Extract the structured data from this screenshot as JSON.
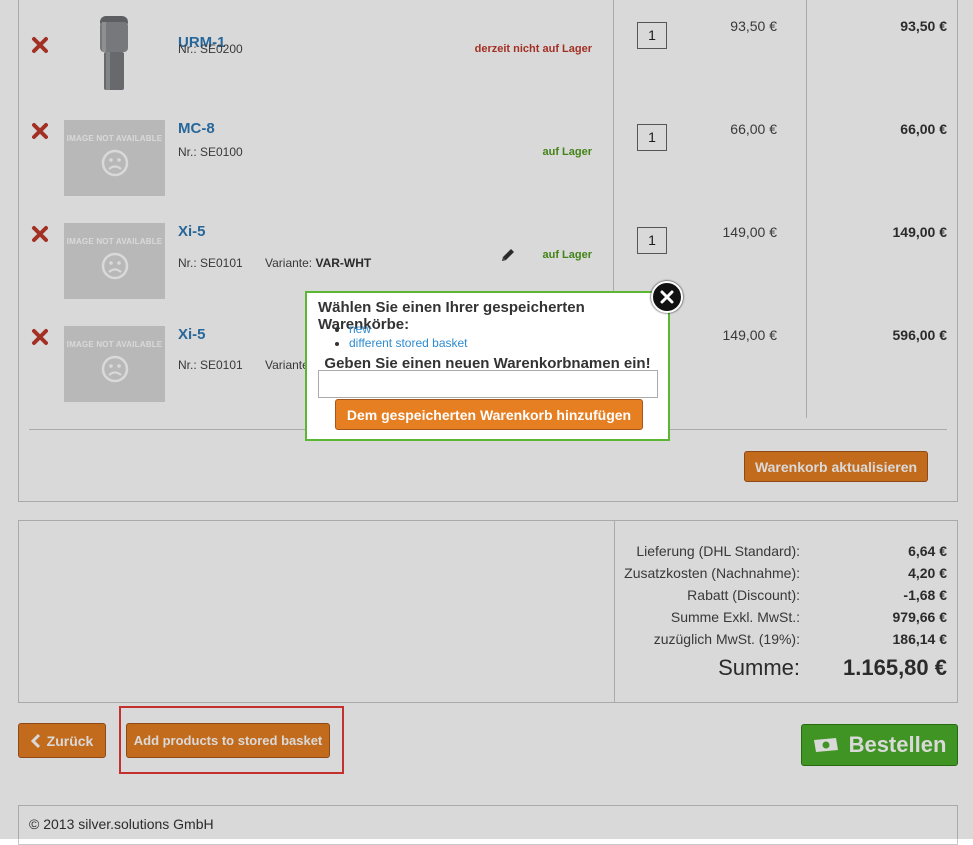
{
  "cart": {
    "items": [
      {
        "name": "URM-1",
        "nr": "Nr.: SE0200",
        "variant_label": "",
        "variant_value": "",
        "stock": "derzeit nicht auf Lager",
        "stock_status": "out",
        "qty": "1",
        "price": "93,50 €",
        "total": "93,50 €",
        "image": "microphone"
      },
      {
        "name": "MC-8",
        "nr": "Nr.: SE0100",
        "variant_label": "",
        "variant_value": "",
        "stock": "auf Lager",
        "stock_status": "in",
        "qty": "1",
        "price": "66,00 €",
        "total": "66,00 €",
        "image": "not-available"
      },
      {
        "name": "Xi-5",
        "nr": "Nr.: SE0101",
        "variant_label": "Variante:",
        "variant_value": "VAR-WHT",
        "stock": "auf Lager",
        "stock_status": "in",
        "qty": "1",
        "price": "149,00 €",
        "total": "149,00 €",
        "image": "not-available"
      },
      {
        "name": "Xi-5",
        "nr": "Nr.: SE0101",
        "variant_label": "Variante",
        "variant_value": "",
        "stock": "",
        "stock_status": "",
        "qty": "",
        "price": "149,00 €",
        "total": "596,00 €",
        "image": "not-available"
      }
    ],
    "image_not_available_text": "IMAGE NOT AVAILABLE",
    "update_button": "Warenkorb aktualisieren"
  },
  "summary": {
    "rows": [
      {
        "label": "Lieferung (DHL Standard):",
        "value": "6,64 €"
      },
      {
        "label": "Zusatzkosten (Nachnahme):",
        "value": "4,20 €"
      },
      {
        "label": "Rabatt (Discount):",
        "value": "-1,68 €"
      },
      {
        "label": "Summe Exkl. MwSt.:",
        "value": "979,66 €"
      },
      {
        "label": "zuzüglich MwSt. (19%):",
        "value": "186,14 €"
      }
    ],
    "total_label": "Summe:",
    "total_value": "1.165,80 €"
  },
  "actions": {
    "back": "Zurück",
    "add_stored": "Add products to stored basket",
    "order": "Bestellen"
  },
  "footer": {
    "copyright": "© 2013 silver.solutions GmbH"
  },
  "modal": {
    "title": "Wählen Sie einen Ihrer gespeicherten Warenkörbe:",
    "baskets": [
      "new",
      "different stored basket"
    ],
    "new_name_label": "Geben Sie einen neuen Warenkorbnamen ein!",
    "input_value": "",
    "submit": "Dem gespeicherten Warenkorb hinzufügen"
  },
  "colors": {
    "accent_orange": "#e67e22",
    "order_green": "#4cae2a",
    "link_blue": "#2e7ab6",
    "out_of_stock": "#c0392b",
    "in_stock": "#4f9a1c",
    "highlight_red": "#e53935",
    "modal_border": "#5bb733"
  }
}
